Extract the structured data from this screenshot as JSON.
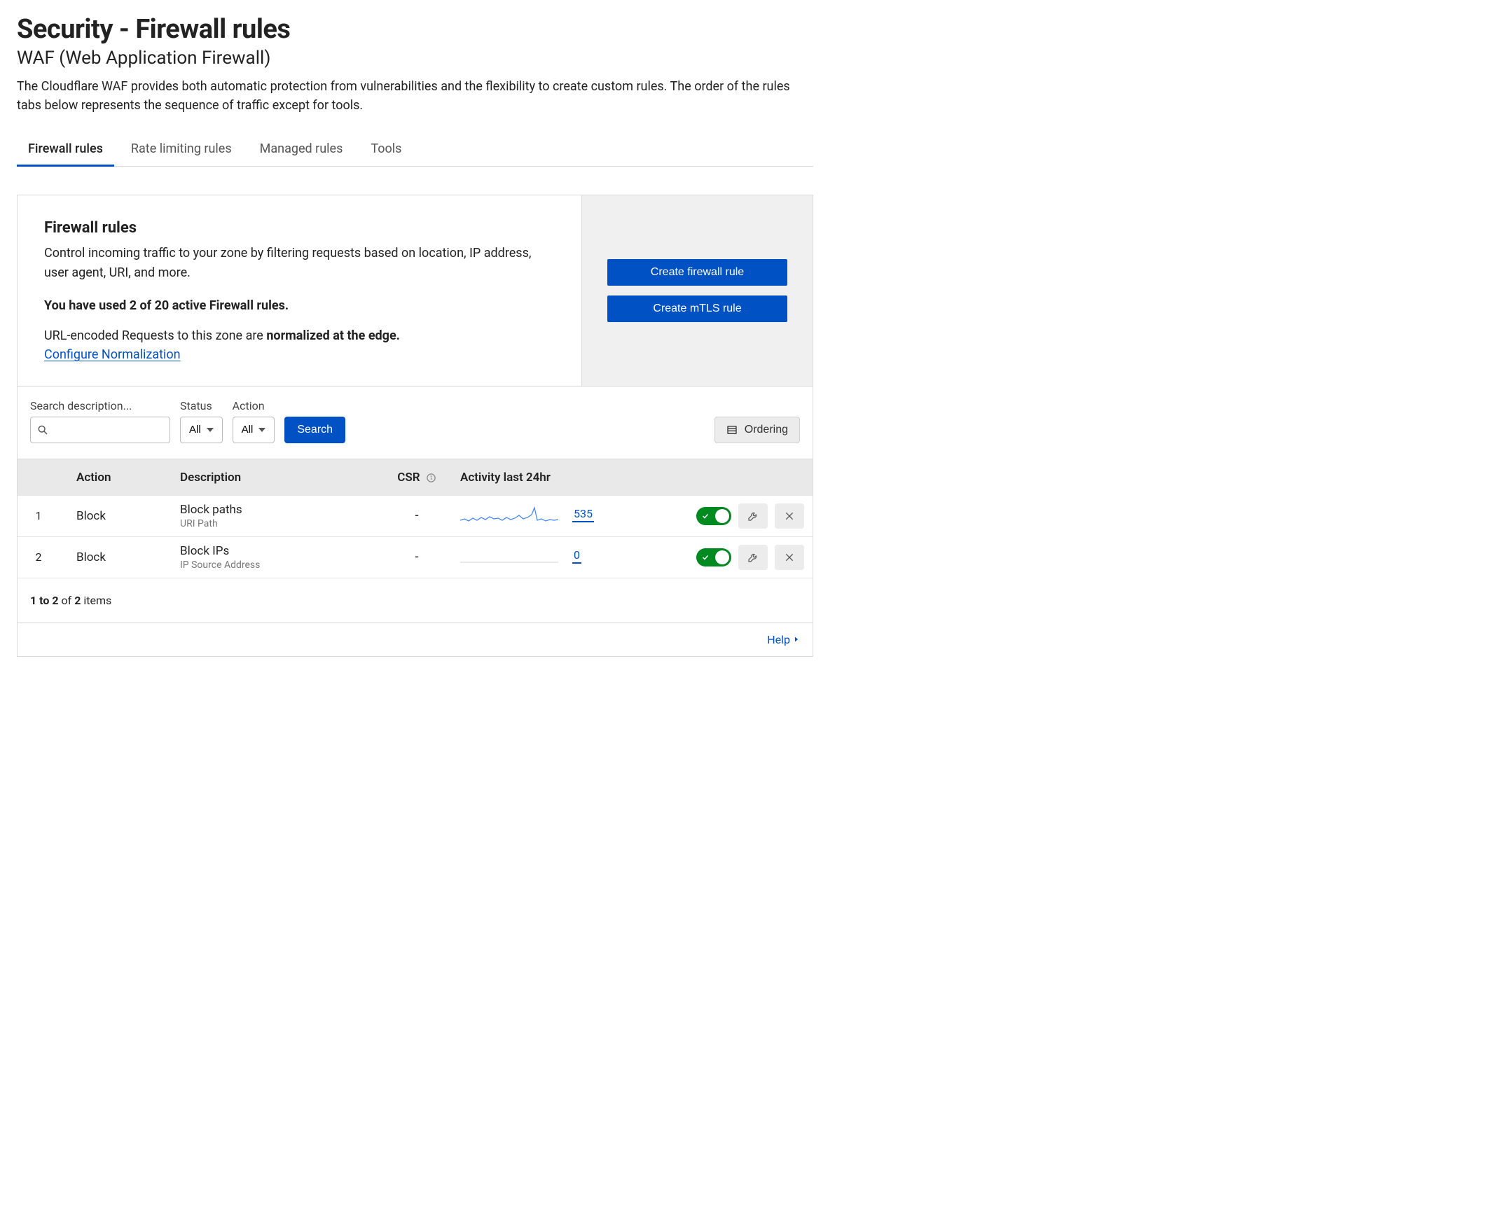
{
  "header": {
    "title": "Security - Firewall rules",
    "subtitle": "WAF (Web Application Firewall)",
    "description": "The Cloudflare WAF provides both automatic protection from vulnerabilities and the flexibility to create custom rules. The order of the rules tabs below represents the sequence of traffic except for tools."
  },
  "tabs": [
    {
      "label": "Firewall rules",
      "active": true
    },
    {
      "label": "Rate limiting rules",
      "active": false
    },
    {
      "label": "Managed rules",
      "active": false
    },
    {
      "label": "Tools",
      "active": false
    }
  ],
  "panel": {
    "title": "Firewall rules",
    "intro": "Control incoming traffic to your zone by filtering requests based on location, IP address, user agent, URI, and more.",
    "usage": "You have used 2 of 20 active Firewall rules.",
    "normalization_prefix": "URL-encoded Requests to this zone are ",
    "normalization_bold": "normalized at the edge.",
    "configure_link": "Configure Normalization",
    "create_firewall_btn": "Create firewall rule",
    "create_mtls_btn": "Create mTLS rule"
  },
  "toolbar": {
    "search_label": "Search description...",
    "search_value": "",
    "status_label": "Status",
    "status_value": "All",
    "action_label": "Action",
    "action_value": "All",
    "search_btn": "Search",
    "ordering_btn": "Ordering"
  },
  "table": {
    "col_action": "Action",
    "col_description": "Description",
    "col_csr": "CSR",
    "col_activity": "Activity last 24hr",
    "rows": [
      {
        "idx": "1",
        "action": "Block",
        "desc_title": "Block paths",
        "desc_sub": "URI Path",
        "csr": "-",
        "activity_count": "535",
        "enabled": true
      },
      {
        "idx": "2",
        "action": "Block",
        "desc_title": "Block IPs",
        "desc_sub": "IP Source Address",
        "csr": "-",
        "activity_count": "0",
        "enabled": true
      }
    ]
  },
  "footer": {
    "pagination": "1 to 2 of 2 items",
    "help": "Help"
  }
}
